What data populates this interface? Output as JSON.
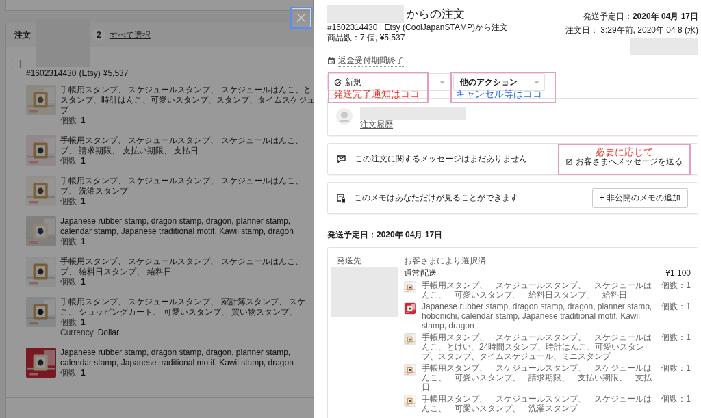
{
  "background": {
    "header": {
      "title": "注文",
      "count": "2",
      "select_all": "すべて選択"
    },
    "order": {
      "checked": false,
      "number": "#1602314430",
      "channel": "(Etsy)",
      "total": "¥5,537"
    },
    "items": [
      {
        "lines": [
          "手帳用スタンプ、 スケジュールスタンプ、 スケジュールはんこ、と",
          "スタンプ、時計はんこ、可愛いスタンプ、スタンプ、タイムスケジュ",
          "プ"
        ],
        "quantity_label": "個数",
        "quantity": "1"
      },
      {
        "lines": [
          "手帳用スタンプ、 スケジュールスタンプ、 スケジュールはんこ、",
          "プ、 請求期限、 支払い期限、 支払日"
        ],
        "quantity_label": "個数",
        "quantity": "1"
      },
      {
        "lines": [
          "手帳用スタンプ、 スケジュールスタンプ、 スケジュールはんこ、",
          "プ、 洗濯スタンプ"
        ],
        "quantity_label": "個数",
        "quantity": "1"
      },
      {
        "lines": [
          "Japanese rubber stamp, dragon stamp, dragon, planner stamp,",
          "calendar stamp, Japanese traditional motif, Kawii stamp, dragon"
        ],
        "quantity_label": "個数",
        "quantity": "1"
      },
      {
        "lines": [
          "手帳用スタンプ、 スケジュールスタンプ、 スケジュールはんこ、",
          "プ、 給料日スタンプ、 給料日"
        ],
        "quantity_label": "個数",
        "quantity": "1"
      },
      {
        "lines": [
          "手帳用スタンプ、 スケジュールスタンプ、 家計簿スタンプ、 スケ",
          "こ、 ショッピングカート、 可愛いスタンプ、 買い物スタンプ、"
        ],
        "quantity_label": "個数",
        "quantity": "1",
        "currency_label": "Currency",
        "currency": "Dollar"
      },
      {
        "lines": [
          "Japanese rubber stamp, dragon stamp, dragon, planner stamp,",
          "calendar stamp, Japanese traditional motif, Kawii stamp, dragon"
        ],
        "quantity_label": "個数",
        "quantity": "1"
      }
    ]
  },
  "drawer": {
    "title_suffix": "からの注文",
    "ship_by": "発送予定日：**2020年 04月 17日**",
    "order_line": [
      {
        "text": "#",
        "link": false
      },
      {
        "text": "1602314430",
        "link": true
      },
      {
        "text": " : Etsy (",
        "link": false
      },
      {
        "text": "CoolJapanSTAMP",
        "link": true
      },
      {
        "text": ")から注文",
        "link": false
      }
    ],
    "order_date": "注文日： 3:29午前, 2020年 04 8 (水)",
    "item_summary": "商品数：7 個, ¥5,537",
    "refund_status": "返金受付期間終了",
    "status_select": {
      "value": "新規",
      "annotation": {
        "text": "発送完了通知はココ",
        "color": "#ee3a32"
      }
    },
    "actions_select": {
      "value": "他のアクション",
      "annotation": {
        "text": "キャンセル等はココ",
        "color": "#2f6ee0"
      }
    },
    "customer": {
      "history_link": "注文履歴"
    },
    "messages": {
      "text": "この注文に関するメッセージはまだありません",
      "button": "お客さまへメッセージを送る",
      "annotation": {
        "text": "必要に応じて",
        "color": "#ee3a32"
      }
    },
    "memo": {
      "text": "このメモはあなただけが見ることができます",
      "button": "+ 非公開のメモの追加"
    },
    "shipping": {
      "heading": "発送予定日：2020年 04月 17日",
      "address_label": "発送先",
      "method_label": "お客さまにより選択済",
      "method": "通常配送",
      "cost": "¥1,100",
      "items": [
        {
          "title": "手帳用スタンプ、　スケジュールスタンプ、　スケジュールはんこ、　可愛いスタンプ、　給料日スタンプ、　給料日",
          "quantity": "個数：1"
        },
        {
          "title": "Japanese rubber stamp, dragon stamp, dragon, planner stamp, hobonichi, calendar stamp, Japanese traditional motif, Kawii stamp, dragon",
          "quantity": "個数：1"
        },
        {
          "title": "手帳用スタンプ、　スケジュールスタンプ、　スケジュールはんこ、とけい、24時間スタンプ、時計はんこ、可愛いスタンプ、スタンプ、タイムスケジュール、ミニスタンプ",
          "quantity": "個数：1"
        },
        {
          "title": "手帳用スタンプ、　スケジュールスタンプ、　スケジュールはんこ、　可愛いスタンプ、　請求期限、　支払い期限、　支払日",
          "quantity": "個数：1"
        },
        {
          "title": "手帳用スタンプ、　スケジュールスタンプ、　スケジュールはんこ、　可愛いスタンプ、　洗濯スタンプ",
          "quantity": "個数：1"
        }
      ]
    }
  }
}
